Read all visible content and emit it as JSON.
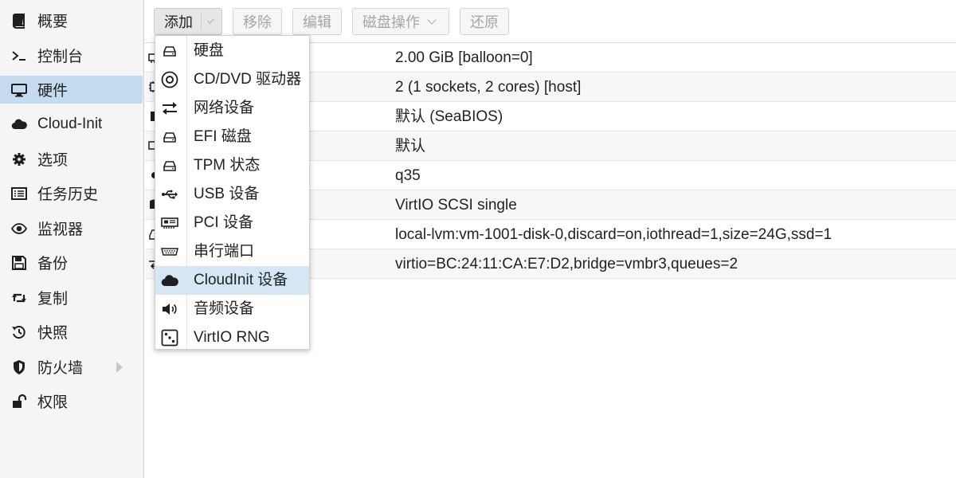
{
  "sidebar": {
    "items": [
      {
        "label": "概要",
        "icon": "book-icon"
      },
      {
        "label": "控制台",
        "icon": "terminal-icon"
      },
      {
        "label": "硬件",
        "icon": "monitor-icon",
        "active": true
      },
      {
        "label": "Cloud-Init",
        "icon": "cloud-icon"
      },
      {
        "label": "选项",
        "icon": "gear-icon"
      },
      {
        "label": "任务历史",
        "icon": "list-icon"
      },
      {
        "label": "监视器",
        "icon": "eye-icon"
      },
      {
        "label": "备份",
        "icon": "floppy-icon"
      },
      {
        "label": "复制",
        "icon": "retweet-icon"
      },
      {
        "label": "快照",
        "icon": "history-icon"
      },
      {
        "label": "防火墙",
        "icon": "shield-icon",
        "expandable": true
      },
      {
        "label": "权限",
        "icon": "unlock-icon"
      }
    ]
  },
  "toolbar": {
    "add_label": "添加",
    "remove_label": "移除",
    "edit_label": "编辑",
    "disk_action_label": "磁盘操作",
    "revert_label": "还原"
  },
  "grid": {
    "rows": [
      {
        "icon": "memory-icon",
        "value": "2.00 GiB [balloon=0]"
      },
      {
        "icon": "cpu-icon",
        "value": "2 (1 sockets, 2 cores) [host]"
      },
      {
        "icon": "bios-icon",
        "value": "默认 (SeaBIOS)"
      },
      {
        "icon": "display-icon",
        "value": "默认"
      },
      {
        "icon": "machine-icon",
        "value": "q35"
      },
      {
        "icon": "database-icon",
        "value": "VirtIO SCSI single"
      },
      {
        "icon": "harddisk-icon",
        "value": "local-lvm:vm-1001-disk-0,discard=on,iothread=1,size=24G,ssd=1"
      },
      {
        "icon": "network-icon",
        "value": "virtio=BC:24:11:CA:E7:D2,bridge=vmbr3,queues=2"
      }
    ]
  },
  "menu": {
    "items": [
      {
        "label": "硬盘",
        "icon": "hdd-icon"
      },
      {
        "label": "CD/DVD 驱动器",
        "icon": "optical-disc-icon"
      },
      {
        "label": "网络设备",
        "icon": "exchange-icon"
      },
      {
        "label": "EFI 磁盘",
        "icon": "hdd-icon"
      },
      {
        "label": "TPM 状态",
        "icon": "hdd-icon"
      },
      {
        "label": "USB 设备",
        "icon": "usb-icon"
      },
      {
        "label": "PCI 设备",
        "icon": "pci-card-icon"
      },
      {
        "label": "串行端口",
        "icon": "serial-port-icon"
      },
      {
        "label": "CloudInit 设备",
        "icon": "cloud-icon",
        "active": true
      },
      {
        "label": "音频设备",
        "icon": "volume-icon"
      },
      {
        "label": "VirtIO RNG",
        "icon": "dice-icon"
      }
    ]
  },
  "colors": {
    "sidebar_bg": "#f5f5f5",
    "active_bg": "#c5dcf0",
    "menu_active_bg": "#d6e6f4",
    "icon": "#1f1f1f"
  }
}
